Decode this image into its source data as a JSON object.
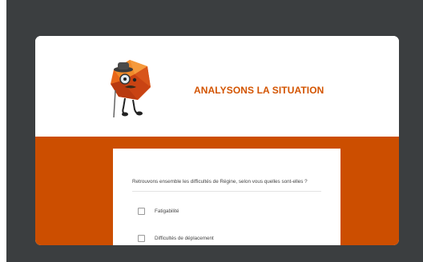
{
  "header": {
    "title": "ANALYSONS LA SITUATION",
    "mascot_icon": "orange-d20-detective-mascot-icon"
  },
  "colors": {
    "accent": "#d35400",
    "band": "#cc4e00",
    "background": "#3b3e40"
  },
  "question": {
    "text": "Retrouvons ensemble les difficultés de Régine, selon vous quelles sont-elles ?",
    "options": [
      {
        "label": "Fatigabilité",
        "checked": false
      },
      {
        "label": "Difficultés de déplacement",
        "checked": false
      }
    ]
  }
}
